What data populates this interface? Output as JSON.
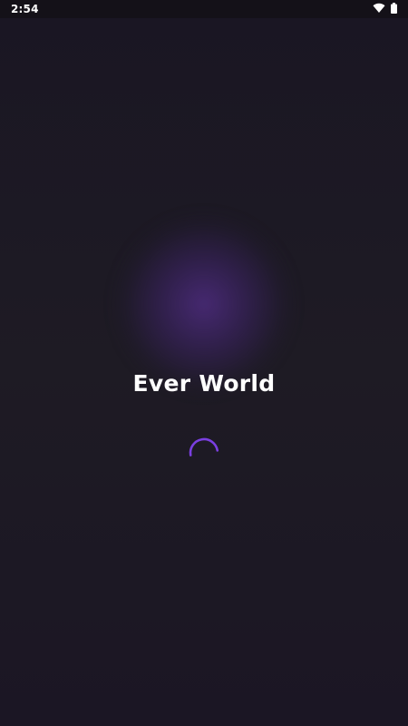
{
  "status_bar": {
    "time": "2:54",
    "icons": [
      "wifi-icon",
      "battery-icon"
    ]
  },
  "splash": {
    "title": "Ever World",
    "loading_indicator": "spinner"
  },
  "colors": {
    "background": "#1b1724",
    "glow": "#3e2468",
    "spinner": "#7a3fe0",
    "title": "#ffffff"
  }
}
